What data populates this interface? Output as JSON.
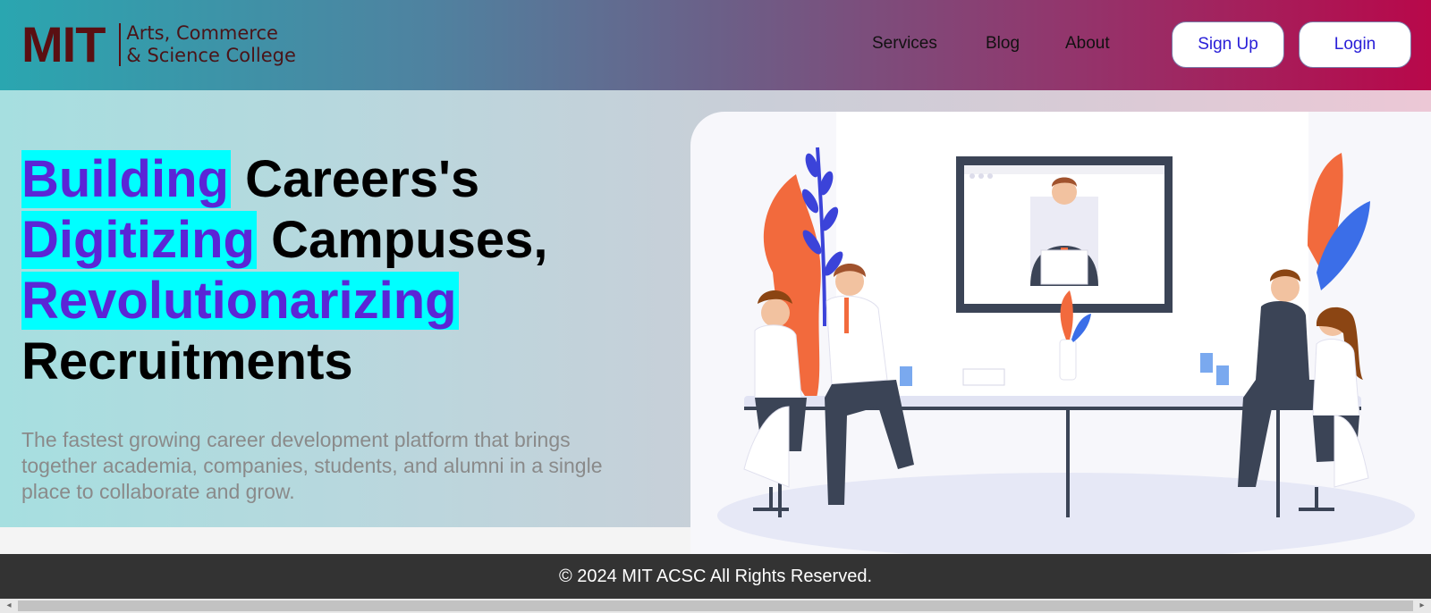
{
  "header": {
    "logo_mark": "MIT",
    "logo_line1": "Arts, Commerce",
    "logo_line2": "& Science College",
    "nav": [
      "Services",
      "Blog",
      "About"
    ],
    "signup_label": "Sign Up",
    "login_label": "Login"
  },
  "hero": {
    "line1_highlight": "Building",
    "line1_rest": " Careers's",
    "line2_highlight": "Digitizing",
    "line2_rest": " Campuses,",
    "line3_highlight": "Revolutionarizing",
    "line4": "Recruitments",
    "subtitle": "The fastest growing career development platform that brings together academia, companies, students, and alumni in a single place to collaborate and grow."
  },
  "footer": {
    "copyright": "© 2024 MIT ACSC All Rights Reserved."
  },
  "colors": {
    "highlight_bg": "#00ffff",
    "highlight_text": "#5b25d6",
    "logo": "#5a0f12",
    "button_text": "#2a20d8",
    "footer_bg": "#333333"
  },
  "icons": [
    "scroll-left-arrow-icon",
    "scroll-right-arrow-icon"
  ]
}
